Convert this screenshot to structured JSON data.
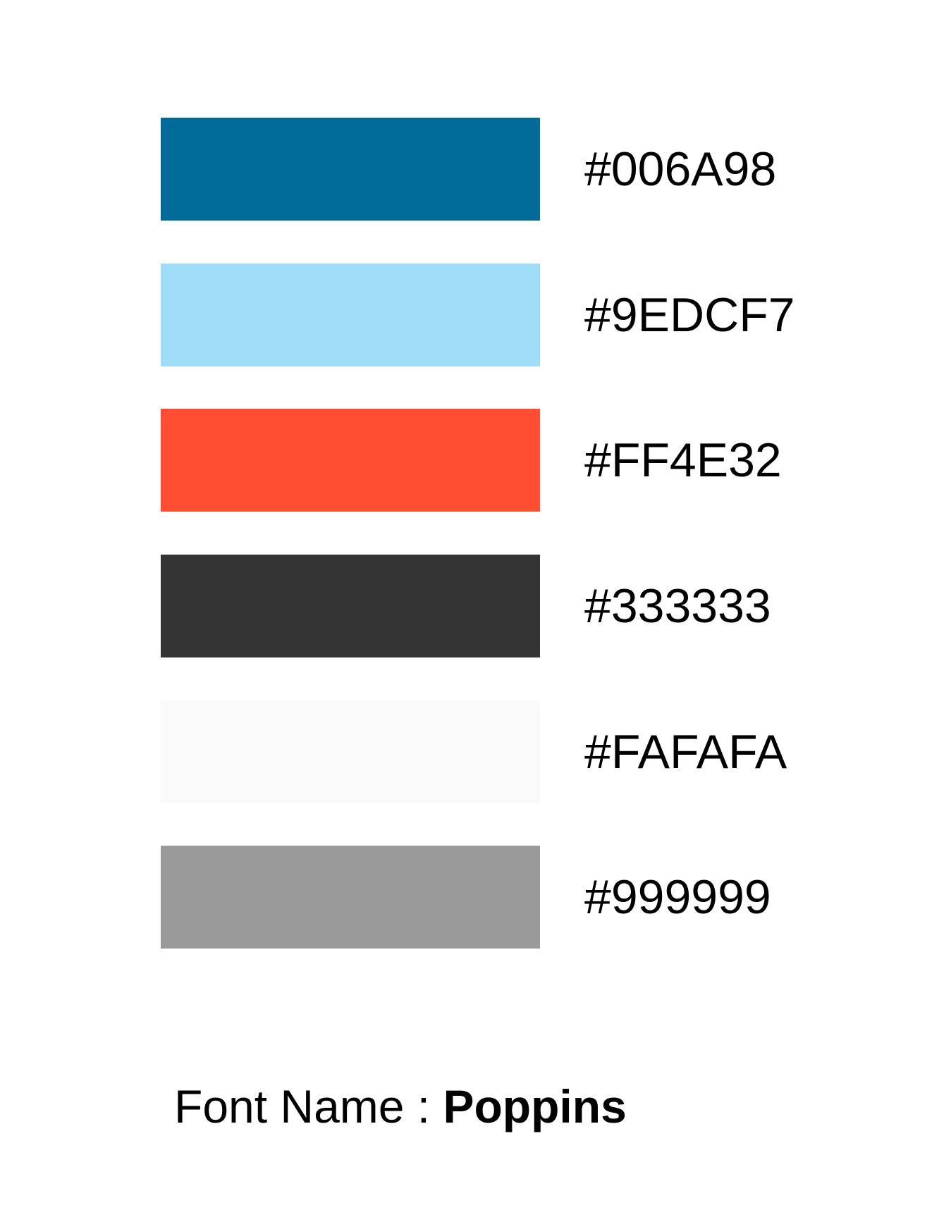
{
  "swatches": [
    {
      "hex": "#006A98",
      "color": "#006A98"
    },
    {
      "hex": "#9EDCF7",
      "color": "#9EDCF7"
    },
    {
      "hex": "#FF4E32",
      "color": "#FF4E32"
    },
    {
      "hex": "#333333",
      "color": "#333333"
    },
    {
      "hex": "#FAFAFA",
      "color": "#FAFAFA"
    },
    {
      "hex": "#999999",
      "color": "#999999"
    }
  ],
  "font": {
    "label": "Font Name : ",
    "value": "Poppins"
  }
}
